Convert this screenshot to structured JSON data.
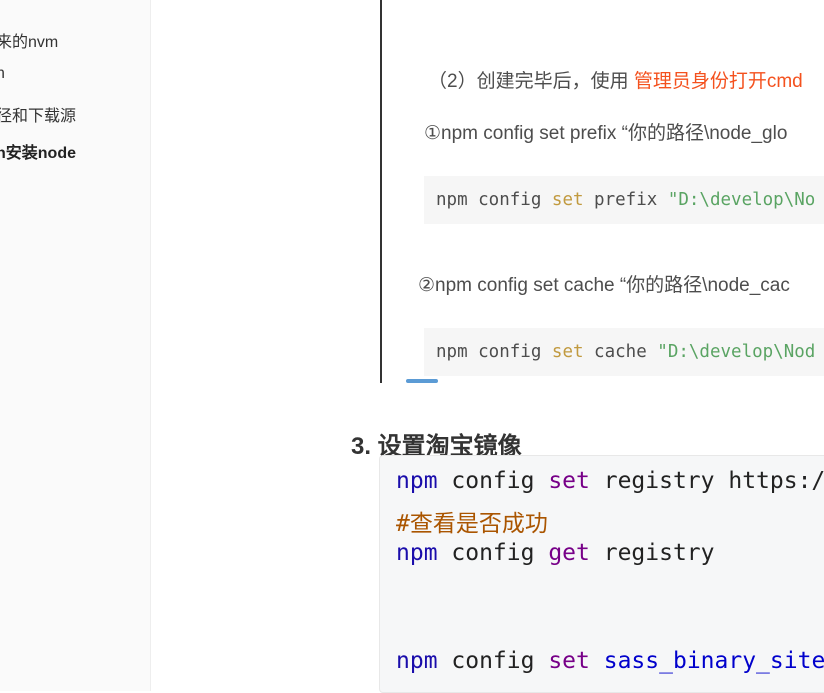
{
  "toc": {
    "items": [
      {
        "label": "来的nvm",
        "active": false
      },
      {
        "label": "n",
        "active": false
      },
      {
        "label": "径和下载源",
        "active": false
      },
      {
        "label": "n安装node",
        "active": true
      }
    ]
  },
  "image": {
    "step_prefix": "（2）创建完毕后，使用 ",
    "step_highlight": "管理员身份打开cmd",
    "item1": "①npm config set prefix “你的路径\\node_glo",
    "code1": {
      "cmd": "npm config ",
      "kw": "set",
      "arg": " prefix ",
      "str": "\"D:\\develop\\No"
    },
    "item2": "②npm config set cache “你的路径\\node_cac",
    "code2": {
      "cmd": "npm config ",
      "kw": "set",
      "arg": " cache ",
      "str": "\"D:\\develop\\Nod"
    }
  },
  "section": {
    "heading": "3. 设置淘宝镜像"
  },
  "code": {
    "line1": {
      "npm": "npm",
      "mid": " config ",
      "kw": "set",
      "rest": " registry https://"
    },
    "line2": {
      "comment": "#查看是否成功"
    },
    "line3": {
      "npm": "npm",
      "mid": " config ",
      "kw": "get",
      "rest": " registry"
    },
    "line4": {
      "npm": "npm",
      "mid": " config ",
      "kw": "set",
      "sp": " ",
      "var": "sass_binary_site",
      "op": "="
    }
  }
}
